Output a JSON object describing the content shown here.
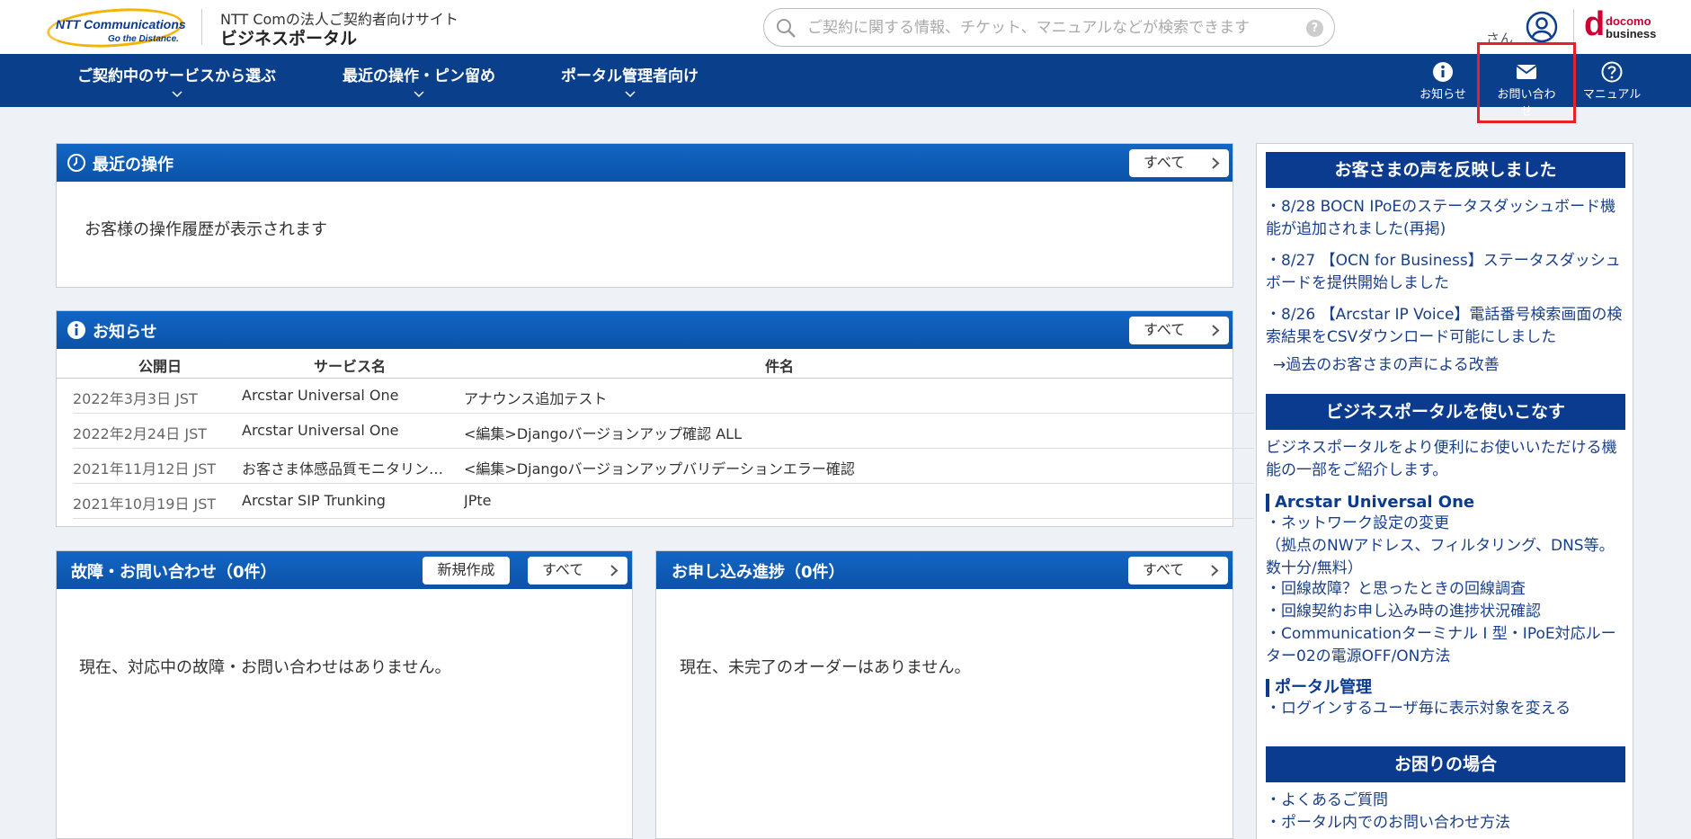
{
  "header": {
    "logo": {
      "brand": "NTT Communications",
      "tagline": "Go the Distance."
    },
    "site_subtitle": "NTT Comの法人ご契約者向けサイト",
    "site_title": "ビジネスポータル",
    "search": {
      "placeholder": "ご契約に関する情報、チケット、マニュアルなどが検索できます",
      "help": "?"
    },
    "user_suffix": "さん",
    "docomo": {
      "d": "d",
      "line1": "docomo",
      "line2": "business"
    }
  },
  "nav": {
    "items": [
      {
        "label": "ご契約中のサービスから選ぶ"
      },
      {
        "label": "最近の操作・ピン留め"
      },
      {
        "label": "ポータル管理者向け"
      }
    ],
    "right": [
      {
        "label": "お知らせ",
        "icon": "info-icon"
      },
      {
        "label": "お問い合わせ",
        "icon": "mail-icon"
      },
      {
        "label": "マニュアル",
        "icon": "help-circle-icon"
      }
    ]
  },
  "recent": {
    "title": "最近の操作",
    "all_label": "すべて",
    "empty": "お客様の操作履歴が表示されます"
  },
  "news": {
    "title": "お知らせ",
    "all_label": "すべて",
    "columns": {
      "date": "公開日",
      "service": "サービス名",
      "subject": "件名"
    },
    "rows": [
      {
        "date": "2022年3月3日 JST",
        "service": "Arcstar Universal One",
        "subject": "アナウンス追加テスト"
      },
      {
        "date": "2022年2月24日 JST",
        "service": "Arcstar Universal One",
        "subject": "<編集>Djangoバージョンアップ確認 ALL"
      },
      {
        "date": "2021年11月12日 JST",
        "service": "お客さま体感品質モニタリン…",
        "subject": "<編集>Djangoバージョンアップバリデーションエラー確認"
      },
      {
        "date": "2021年10月19日 JST",
        "service": "Arcstar SIP Trunking",
        "subject": "JPte"
      }
    ]
  },
  "trouble": {
    "title": "故障・お問い合わせ（0件）",
    "new_label": "新規作成",
    "all_label": "すべて",
    "empty": "現在、対応中の故障・お問い合わせはありません。"
  },
  "orders": {
    "title": "お申し込み進捗（0件）",
    "all_label": "すべて",
    "empty": "現在、未完了のオーダーはありません。"
  },
  "sidebar": {
    "voice": {
      "title": "お客さまの声を反映しました",
      "items": [
        "・8/28 BOCN IPoEのステータスダッシュボード機能が追加されました(再掲)",
        "・8/27 【OCN for Business】ステータスダッシュボードを提供開始しました",
        "・8/26 【Arcstar IP Voice】電話番号検索画面の検索結果をCSVダウンロード可能にしました"
      ],
      "past_link": "→過去のお客さまの声による改善"
    },
    "tips": {
      "title": "ビジネスポータルを使いこなす",
      "intro": "ビジネスポータルをより便利にお使いいただける機能の一部をご紹介します。",
      "section1": "Arcstar Universal One",
      "s1_items": [
        "・ネットワーク設定の変更",
        "（拠点のNWアドレス、フィルタリング、DNS等。数十分/無料）",
        "・回線故障？と思ったときの回線調査",
        "・回線契約お申し込み時の進捗状況確認",
        "・Communicationターミナル I 型・IPoE対応ルーター02の電源OFF/ON方法"
      ],
      "section2": "ポータル管理",
      "s2_items": [
        "・ログインするユーザ毎に表示対象を変える"
      ]
    },
    "trouble_help": {
      "title": "お困りの場合",
      "items": [
        "・よくあるご質問",
        "・ポータル内でのお問い合わせ方法"
      ]
    }
  }
}
